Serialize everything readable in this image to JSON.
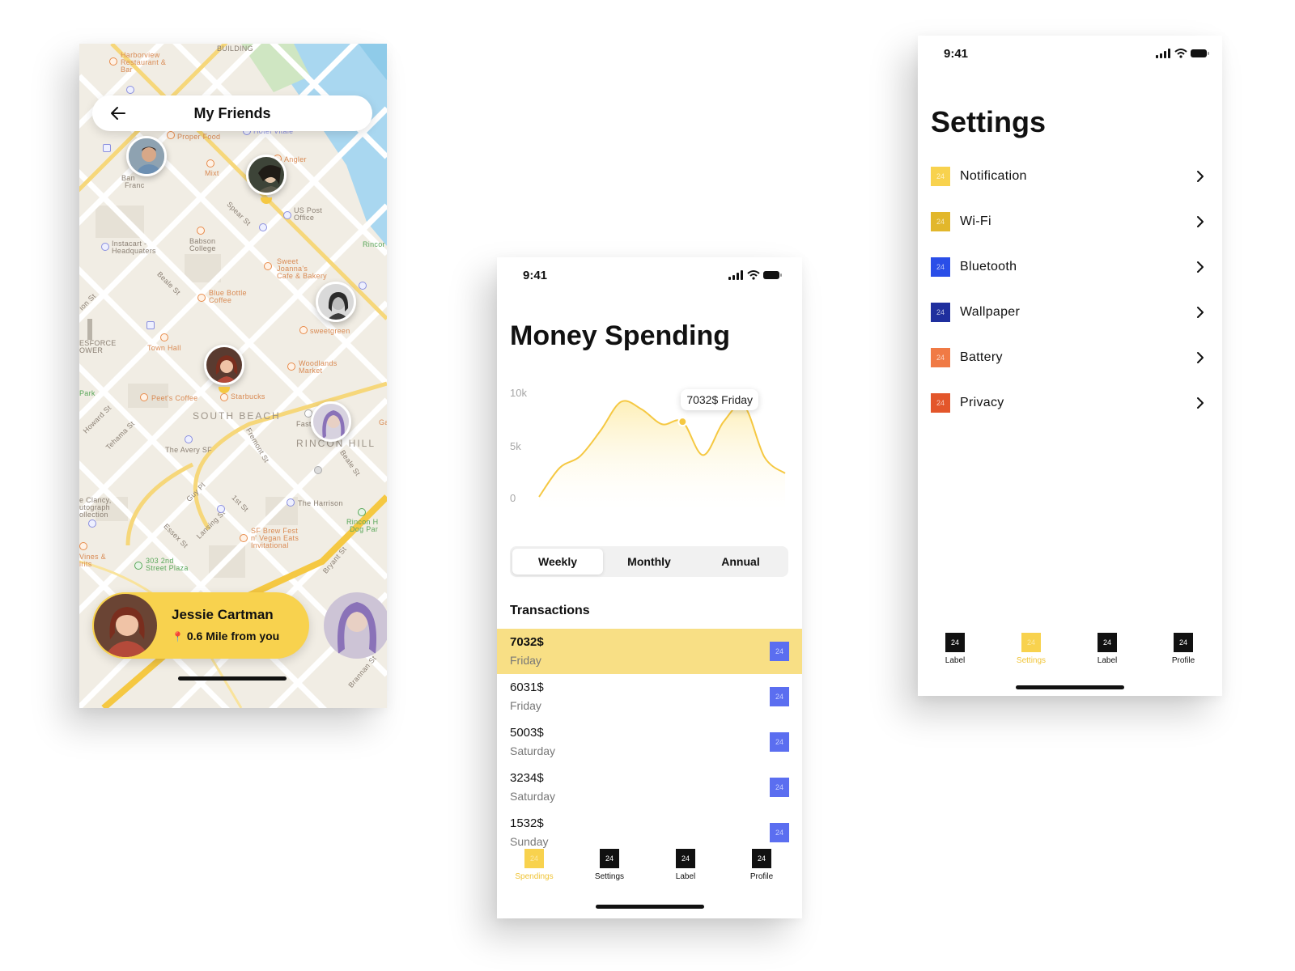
{
  "map_screen": {
    "header_title": "My Friends",
    "map_labels": {
      "harborview": "Harborview",
      "restaurant": "Restaurant &",
      "bar": "Bar",
      "ferry_building": "BUILDING",
      "proper_food": "Proper Food",
      "hotel_vitale": "Hotel Vitale",
      "angler": "Angler",
      "mixt": "Mixt",
      "bank_sf_1": "Ban",
      "bank_sf_2": "Franc",
      "us_post_1": "US Post",
      "us_post_2": "Office",
      "spear_st": "Spear St",
      "instacart_1": "Instacart -",
      "instacart_2": "Headquaters",
      "babson_1": "Babson",
      "babson_2": "College",
      "rincon": "Rincor",
      "sweet_1": "Sweet",
      "sweet_2": "Joanna's",
      "sweet_3": "Cafe & Bakery",
      "blue_bottle_1": "Blue Bottle",
      "blue_bottle_2": "Coffee",
      "beale_st": "Beale St",
      "mission_st": "ion St",
      "salesforce_1": "ESFORCE",
      "salesforce_2": "OWER",
      "sweetgreen": "sweetgreen",
      "town_hall": "Town Hall",
      "woodlands_1": "Woodlands",
      "woodlands_2": "Market",
      "park": "Park",
      "howard_st": "Howard St",
      "peets": "Peet's Coffee",
      "starbucks": "Starbucks",
      "south_beach": "SOUTH BEACH",
      "tehama_st": "Tehama St",
      "fast": "Fast",
      "ga": "Ga",
      "avery": "The Avery SF",
      "fremont_st": "Fremont St",
      "rincon_hill": "RINCON HILL",
      "beale_st_2": "Beale St",
      "clancy_1": "e Clancy,",
      "clancy_2": "utograph",
      "clancy_3": "ollection",
      "guy_pl": "Guy Pl",
      "first_st": "1st St",
      "harrison": "The Harrison",
      "rincon_dog_1": "Rincon H",
      "rincon_dog_2": "Dog Par",
      "lansing_st": "Lansing St",
      "essex_st": "Essex St",
      "brew_fest_1": "SF Brew Fest",
      "brew_fest_2": "n' Vegan Eats",
      "brew_fest_3": "Invitational",
      "vines_1": "Vines &",
      "vines_2": "irits",
      "plaza_1": "303 2nd",
      "plaza_2": "Street Plaza",
      "bryant_st": "Bryant St",
      "brannan_st": "Brannan St"
    },
    "card": {
      "name": "Jessie Cartman",
      "distance_icon": "📍",
      "distance": "0.6 Mile from you"
    },
    "icons": {
      "back": "arrow-left-icon"
    }
  },
  "money_screen": {
    "status_time": "9:41",
    "title": "Money Spending",
    "chart_data": {
      "type": "area",
      "title": "",
      "x": [
        0,
        1,
        2,
        3,
        4,
        5,
        6,
        7,
        8,
        9,
        10,
        11,
        12
      ],
      "values": [
        0,
        2700,
        3800,
        6200,
        8900,
        8200,
        6800,
        7032,
        3900,
        7032,
        8500,
        3700,
        2200
      ],
      "y_ticks": [
        "10k",
        "5k",
        "0"
      ],
      "ylim": [
        0,
        10000
      ],
      "grid": false,
      "highlight": {
        "index": 7,
        "label": "7032$ Friday"
      },
      "colors": {
        "line": "#f5c842",
        "fill_top": "#fdefb8",
        "fill_bottom": "#ffffff"
      }
    },
    "segments": [
      {
        "label": "Weekly",
        "active": true
      },
      {
        "label": "Monthly",
        "active": false
      },
      {
        "label": "Annual",
        "active": false
      }
    ],
    "transactions_title": "Transactions",
    "transactions": [
      {
        "amount": "7032$",
        "day": "Friday",
        "icon": "24",
        "highlight": true
      },
      {
        "amount": "6031$",
        "day": "Friday",
        "icon": "24",
        "highlight": false
      },
      {
        "amount": "5003$",
        "day": "Saturday",
        "icon": "24",
        "highlight": false
      },
      {
        "amount": "3234$",
        "day": "Saturday",
        "icon": "24",
        "highlight": false
      },
      {
        "amount": "1532$",
        "day": "Sunday",
        "icon": "24",
        "highlight": false
      }
    ],
    "tabs": [
      {
        "label": "Spendings",
        "icon": "24",
        "active": true
      },
      {
        "label": "Settings",
        "icon": "24",
        "active": false
      },
      {
        "label": "Label",
        "icon": "24",
        "active": false
      },
      {
        "label": "Profile",
        "icon": "24",
        "active": false
      }
    ]
  },
  "settings_screen": {
    "status_time": "9:41",
    "title": "Settings",
    "items": [
      {
        "label": "Notification",
        "icon": "24",
        "color": "#f8d24e"
      },
      {
        "label": "Wi-Fi",
        "icon": "24",
        "color": "#e2b72b"
      },
      {
        "label": "Bluetooth",
        "icon": "24",
        "color": "#2a4ee8"
      },
      {
        "label": "Wallpaper",
        "icon": "24",
        "color": "#1f2f9e"
      },
      {
        "label": "Battery",
        "icon": "24",
        "color": "#f07a45"
      },
      {
        "label": "Privacy",
        "icon": "24",
        "color": "#e3562b"
      }
    ],
    "tabs": [
      {
        "label": "Label",
        "icon": "24",
        "active": false
      },
      {
        "label": "Settings",
        "icon": "24",
        "active": true
      },
      {
        "label": "Label",
        "icon": "24",
        "active": false
      },
      {
        "label": "Profile",
        "icon": "24",
        "active": false
      }
    ]
  }
}
